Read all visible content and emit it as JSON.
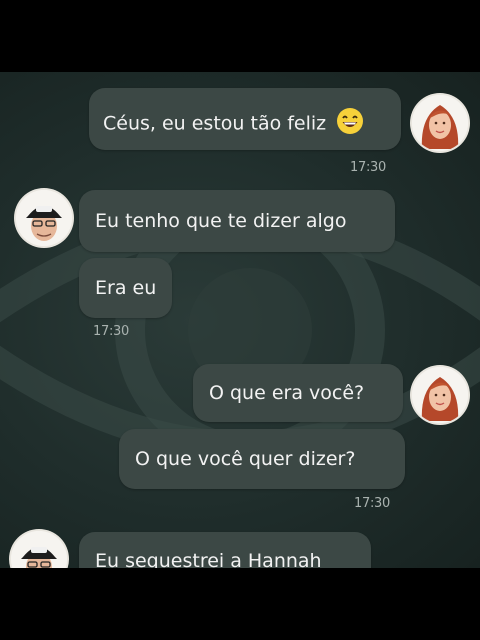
{
  "messages": [
    {
      "sender": "her",
      "text": "Céus, eu estou tão feliz",
      "emoji": "grinning-face-icon"
    },
    {
      "sender": "him",
      "text": "Eu tenho que te dizer algo"
    },
    {
      "sender": "him",
      "text": "Era eu"
    },
    {
      "sender": "her",
      "text": "O que era você?"
    },
    {
      "sender": "her",
      "text": "O que você quer dizer?"
    },
    {
      "sender": "him",
      "text": "Eu sequestrei a Hannah"
    }
  ],
  "timestamps": [
    "17:30",
    "17:30",
    "17:30"
  ],
  "colors": {
    "background": "#1f2d2b",
    "bubble": "#3c4845",
    "text": "#f2f2f2",
    "timestamp": "#a9b2af"
  }
}
